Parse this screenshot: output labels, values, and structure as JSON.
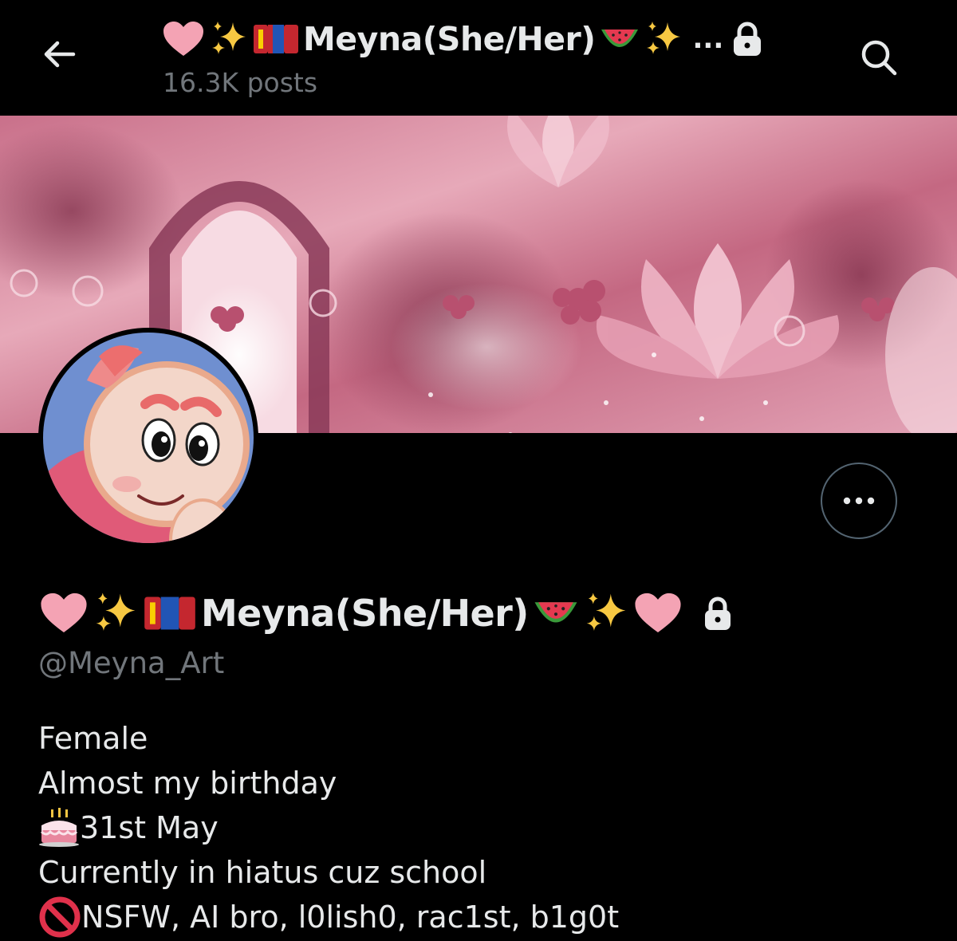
{
  "header": {
    "title": "Meyna(She/Her)",
    "overflow": "...",
    "posts_count": "16.3K posts",
    "back_icon": "arrow-left-icon",
    "search_icon": "search-icon"
  },
  "profile": {
    "display_name": "Meyna(She/Her)",
    "handle": "@Meyna_Art",
    "more_icon": "more-icon",
    "protected": true
  },
  "bio": {
    "lines": [
      "Female",
      "Almost my birthday",
      "31st May",
      "Currently in hiatus cuz school",
      "NSFW, AI bro, l0lish0, rac1st, b1g0t"
    ]
  },
  "colors": {
    "background": "#000000",
    "text": "#e7e9ea",
    "secondary": "#71767b",
    "heart": "#f4a3b4",
    "banner_pink": "#d9879c"
  }
}
